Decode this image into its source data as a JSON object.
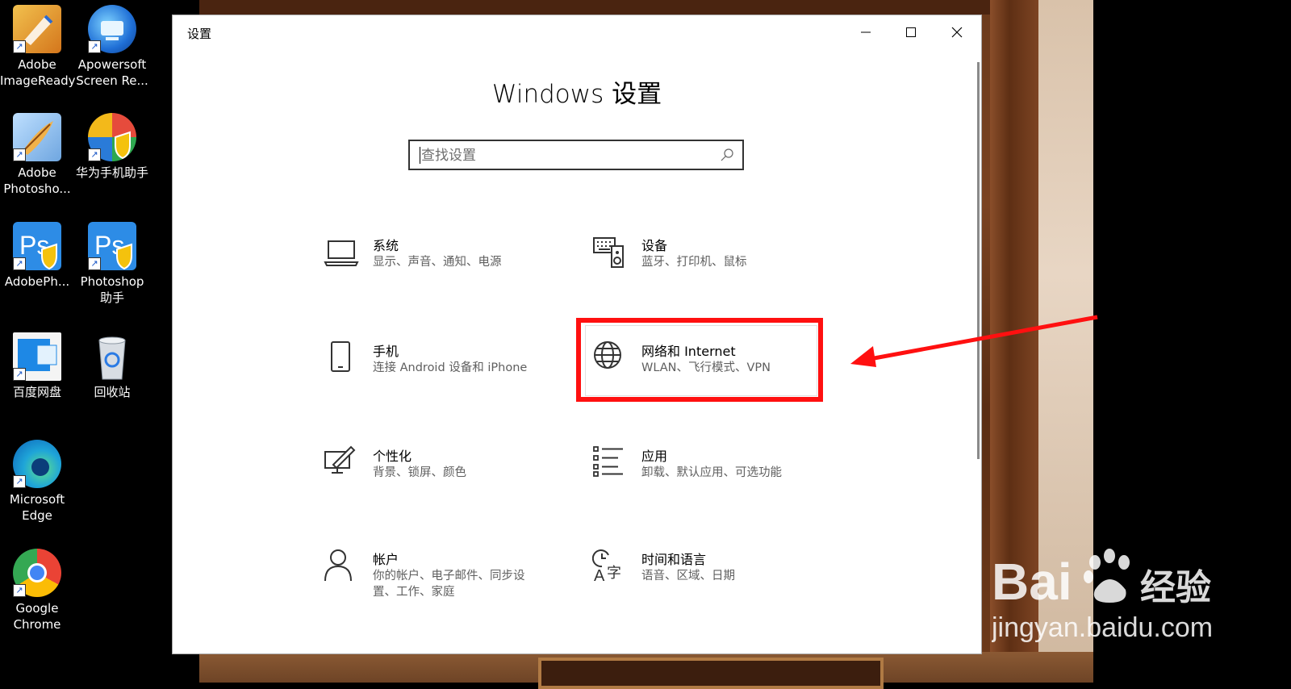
{
  "desktop": {
    "icons": [
      {
        "label": "Adobe\nImageReady",
        "icon": "imageready-icon"
      },
      {
        "label": "Apowersoft\nScreen Re...",
        "icon": "apowersoft-icon"
      },
      {
        "label": "Adobe\nPhotosho...",
        "icon": "photoshop-feather-icon"
      },
      {
        "label": "华为手机助手",
        "icon": "huawei-assistant-icon"
      },
      {
        "label": "AdobePh...",
        "icon": "photoshop-icon"
      },
      {
        "label": "Photoshop\n助手",
        "icon": "photoshop-helper-icon"
      },
      {
        "label": "百度网盘",
        "icon": "baidu-netdisk-icon"
      },
      {
        "label": "回收站",
        "icon": "recycle-bin-icon"
      },
      {
        "label": "Microsoft\nEdge",
        "icon": "edge-icon"
      },
      {
        "label": "Google\nChrome",
        "icon": "chrome-icon"
      }
    ]
  },
  "window": {
    "title": "设置",
    "heading": "Windows 设置",
    "search_placeholder": "查找设置"
  },
  "categories": [
    {
      "title": "系统",
      "desc": "显示、声音、通知、电源",
      "icon": "laptop-icon"
    },
    {
      "title": "设备",
      "desc": "蓝牙、打印机、鼠标",
      "icon": "devices-icon"
    },
    {
      "title": "手机",
      "desc": "连接 Android 设备和 iPhone",
      "icon": "phone-icon"
    },
    {
      "title": "网络和 Internet",
      "desc": "WLAN、飞行模式、VPN",
      "icon": "globe-icon"
    },
    {
      "title": "个性化",
      "desc": "背景、锁屏、颜色",
      "icon": "personalization-icon"
    },
    {
      "title": "应用",
      "desc": "卸载、默认应用、可选功能",
      "icon": "apps-list-icon"
    },
    {
      "title": "帐户",
      "desc": "你的帐户、电子邮件、同步设置、工作、家庭",
      "icon": "person-icon"
    },
    {
      "title": "时间和语言",
      "desc": "语音、区域、日期",
      "icon": "time-language-icon"
    }
  ],
  "annotation": {
    "color": "#ff1010",
    "highlighted": "网络和 Internet"
  },
  "watermark": {
    "brand": "Bai",
    "brand_suffix": "经验",
    "url": "jingyan.baidu.com"
  }
}
